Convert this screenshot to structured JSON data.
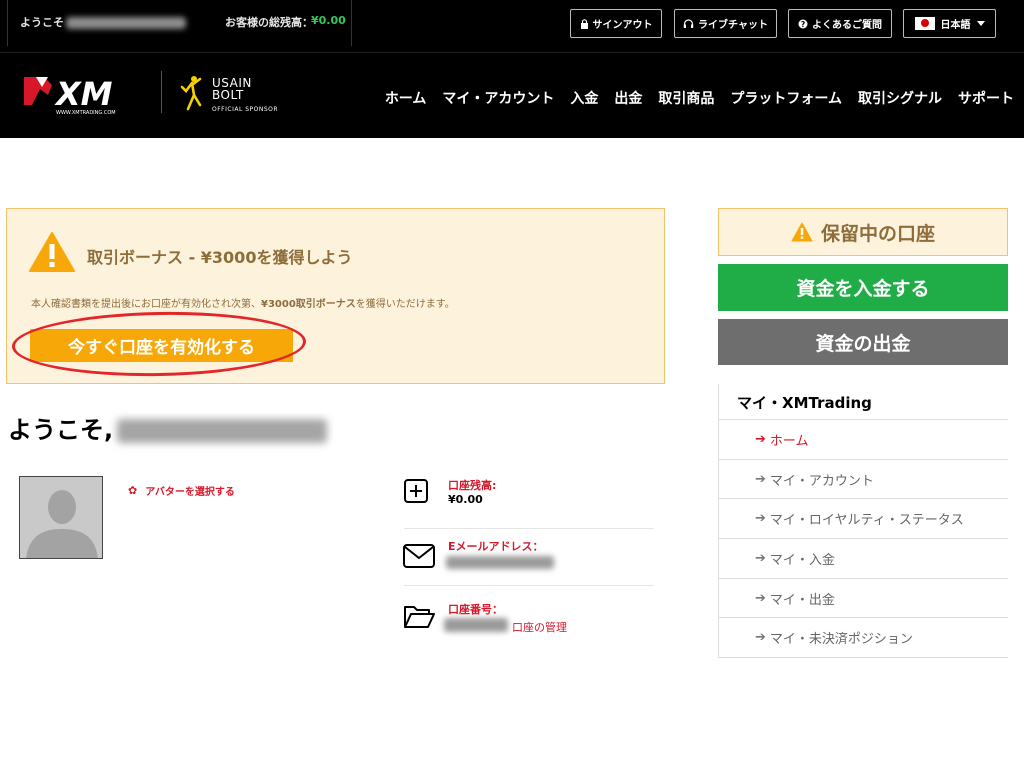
{
  "topbar": {
    "welcome": "ようこそ",
    "balance_label": "お客様の総残高：",
    "balance_value": "¥0.00",
    "signout": "サインアウト",
    "livechat": "ライブチャット",
    "faq": "よくあるご質問",
    "language": "日本語"
  },
  "header": {
    "logo_text": "XM",
    "logo_sub": "WWW.XMTRADING.COM",
    "sponsor_line1": "USAIN",
    "sponsor_line2": "BOLT",
    "sponsor_official": "OFFICIAL SPONSOR",
    "nav": [
      "ホーム",
      "マイ・アカウント",
      "入金",
      "出金",
      "取引商品",
      "プラットフォーム",
      "取引シグナル",
      "サポート"
    ]
  },
  "bonus": {
    "title": "取引ボーナス - ¥3000を獲得しよう",
    "desc_prefix": "本人確認書類を提出後にお口座が有効化され次第、",
    "desc_bold": "¥3000取引ボーナス",
    "desc_suffix": "を獲得いただけます。",
    "cta": "今すぐ口座を有効化する"
  },
  "main": {
    "welcome": "ようこそ,",
    "avatar_link": "アバターを選択する",
    "balance_label": "口座残高:",
    "balance_value": "¥0.00",
    "email_label": "Eメールアドレス：",
    "account_label": "口座番号：",
    "manage_link": "口座の管理"
  },
  "sidebar": {
    "pending": "保留中の口座",
    "deposit": "資金を入金する",
    "withdraw": "資金の出金",
    "heading": "マイ・XMTrading",
    "items": [
      {
        "label": "ホーム"
      },
      {
        "label": "マイ・アカウント"
      },
      {
        "label": "マイ・ロイヤルティ・ステータス"
      },
      {
        "label": "マイ・入金"
      },
      {
        "label": "マイ・出金"
      },
      {
        "label": "マイ・未決済ポジション"
      }
    ]
  },
  "colors": {
    "accent_red": "#d7182a",
    "cta_orange": "#f7a707",
    "deposit_green": "#20ac46",
    "withdraw_gray": "#6e6e6e",
    "notice_bg": "#fdf2dc",
    "notice_border": "#f1c46c",
    "balance_green": "#34c759"
  },
  "icons": {
    "lock": "lock-icon",
    "headset": "headset-icon",
    "question": "question-icon",
    "warning": "warning-icon",
    "gear": "gear-icon",
    "plus_square": "plus-square-icon",
    "envelope": "envelope-icon",
    "folder": "folder-open-icon",
    "arrow": "arrow-right-icon"
  }
}
